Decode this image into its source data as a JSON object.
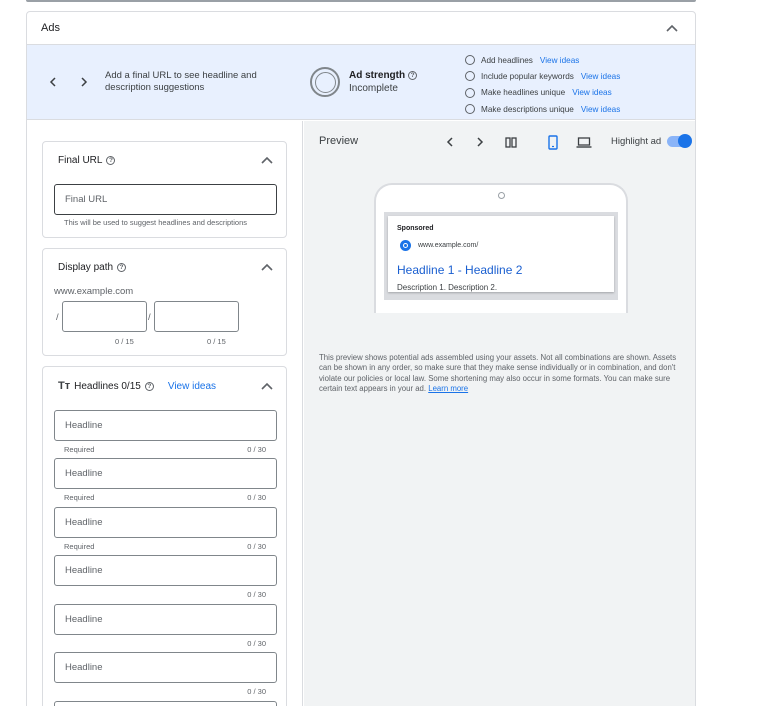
{
  "panel": {
    "title": "Ads"
  },
  "banner": {
    "message": "Add a final URL to see headline and description suggestions",
    "strength_title": "Ad strength",
    "strength_status": "Incomplete",
    "tips": [
      {
        "label": "Add headlines",
        "link": "View ideas"
      },
      {
        "label": "Include popular keywords",
        "link": "View ideas"
      },
      {
        "label": "Make headlines unique",
        "link": "View ideas"
      },
      {
        "label": "Make descriptions unique",
        "link": "View ideas"
      }
    ]
  },
  "final_url": {
    "title": "Final URL",
    "placeholder": "Final URL",
    "helper": "This will be used to suggest headlines and descriptions"
  },
  "display_path": {
    "title": "Display path",
    "base_url": "www.example.com",
    "separator": "/",
    "counter1": "0 / 15",
    "counter2": "0 / 15"
  },
  "headlines": {
    "title": "Headlines 0/15",
    "link": "View ideas",
    "fields": [
      {
        "placeholder": "Headline",
        "required": "Required",
        "counter": "0 / 30"
      },
      {
        "placeholder": "Headline",
        "required": "Required",
        "counter": "0 / 30"
      },
      {
        "placeholder": "Headline",
        "required": "Required",
        "counter": "0 / 30"
      },
      {
        "placeholder": "Headline",
        "required": "",
        "counter": "0 / 30"
      },
      {
        "placeholder": "Headline",
        "required": "",
        "counter": "0 / 30"
      },
      {
        "placeholder": "Headline",
        "required": "",
        "counter": "0 / 30"
      }
    ]
  },
  "preview": {
    "title": "Preview",
    "highlight_label": "Highlight ad",
    "highlight_on": true,
    "ad": {
      "sponsored": "Sponsored",
      "url": "www.example.com/",
      "headline": "Headline 1 - Headline 2",
      "description": "Description 1. Description 2."
    },
    "note": "This preview shows potential ads assembled using your assets. Not all combinations are shown. Assets can be shown in any order, so make sure that they make sense individually or in combination, and don't violate our policies or local law. Some shortening may also occur in some formats. You can make sure certain text appears in your ad.",
    "learn_more": "Learn more"
  },
  "colors": {
    "accent": "#1a73e8",
    "banner_bg": "#e8f0fe",
    "preview_bg": "#f1f3f4"
  }
}
